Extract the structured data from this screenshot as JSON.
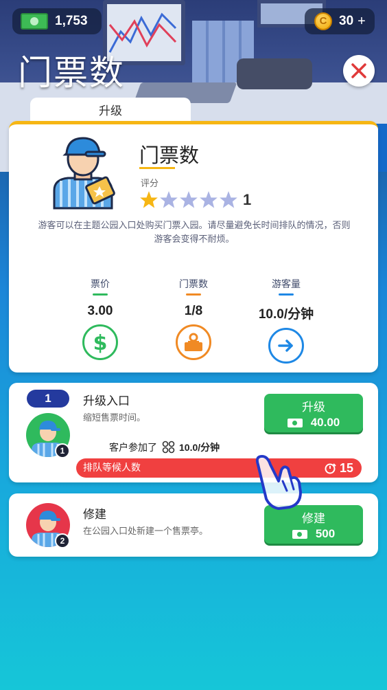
{
  "currency": {
    "cash": "1,753",
    "coins": "30",
    "coins_add": "+"
  },
  "header": {
    "title": "门票数"
  },
  "tab": {
    "label": "升级"
  },
  "card": {
    "title": "门票数",
    "rating_label": "评分",
    "rating_value": "1",
    "stars_filled": 1,
    "stars_total": 5,
    "description": "游客可以在主题公园入口处购买门票入园。请尽量避免长时间排队的情况，否则游客会变得不耐烦。",
    "stats": [
      {
        "label": "票价",
        "value": "3.00",
        "color": "#2fba5d",
        "icon": "dollar-icon"
      },
      {
        "label": "门票数",
        "value": "1/8",
        "color": "#f08a24",
        "icon": "ticket-booth-icon"
      },
      {
        "label": "游客量",
        "value": "10.0/分钟",
        "color": "#1e88e5",
        "icon": "arrow-right-icon"
      }
    ]
  },
  "upgrade_row": {
    "level": "1",
    "badge": "1",
    "title": "升级入口",
    "subtitle": "缩短售票时间。",
    "button_label": "升级",
    "button_price": "40.00",
    "customers_label": "客户参加了",
    "customers_rate": "10.0/分钟",
    "queue_label": "排队等候人数",
    "queue_count": "15"
  },
  "build_row": {
    "badge": "2",
    "title": "修建",
    "subtitle": "在公园入口处新建一个售票亭。",
    "button_label": "修建",
    "button_price": "500"
  },
  "colors": {
    "accent_yellow": "#f6b614",
    "green": "#2fba5d",
    "red": "#f04040",
    "navy": "#243a9e"
  }
}
